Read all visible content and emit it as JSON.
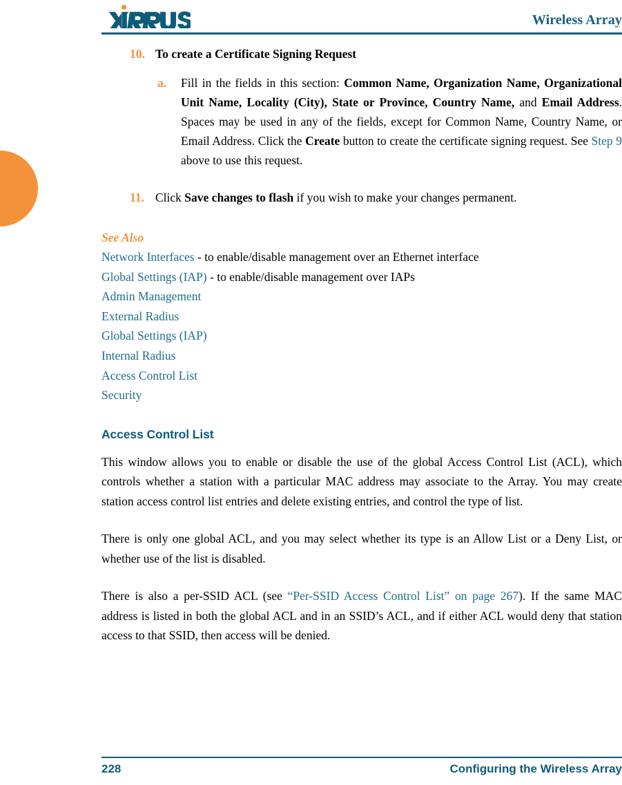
{
  "header": {
    "logo_text": "XIRRUS",
    "logo_trademark": "®",
    "title": "Wireless Array"
  },
  "colors": {
    "teal": "#0d5c79",
    "link_teal": "#1d6e8c",
    "orange": "#f4923b",
    "text": "#000000"
  },
  "steps": [
    {
      "marker": "10.",
      "text": "To create a Certificate Signing Request",
      "substeps": [
        {
          "marker": "a.",
          "seg1": "Fill in the fields in this section: ",
          "b1": "Common Name, Organization Name, Organizational Unit Name, Locality (City), State or Province, Country Name,",
          "seg2": " and ",
          "b2": "Email Address",
          "seg3": ". Spaces may be used in any of the fields, except for Common Name, Country Name, or Email Address. Click the ",
          "b3": "Create",
          "seg4": " button to create the certificate signing request. See ",
          "link": "Step 9",
          "seg5": " above to use this request."
        }
      ]
    },
    {
      "marker": "11.",
      "seg1": "Click ",
      "b1": "Save changes to flash",
      "seg2": " if you wish to make your changes permanent."
    }
  ],
  "see_also": {
    "title": "See Also",
    "entries": [
      {
        "link": "Network Interfaces",
        "suffix": " - to enable/disable management over an Ethernet interface"
      },
      {
        "link": "Global Settings (IAP)",
        "suffix": " - to enable/disable management over IAPs"
      },
      {
        "link": "Admin Management",
        "suffix": ""
      },
      {
        "link": "External Radius",
        "suffix": ""
      },
      {
        "link": "Global Settings (IAP)",
        "suffix": ""
      },
      {
        "link": "Internal Radius",
        "suffix": ""
      },
      {
        "link": "Access Control List",
        "suffix": ""
      },
      {
        "link": "Security",
        "suffix": ""
      }
    ]
  },
  "section": {
    "heading": "Access Control List",
    "paragraphs": [
      "This window allows you to enable or disable the use of the global Access Control List (ACL), which controls whether a station with a particular MAC address may associate to the Array. You may create station access control list entries and delete existing entries, and control the type of list.",
      "There is only one global ACL, and you may select whether its type is an Allow List or a Deny List, or whether use of the list is disabled."
    ],
    "final_paragraph": {
      "seg1": "There is also a per-SSID ACL (see ",
      "link": "“Per-SSID Access Control List” on page 267",
      "seg2": "). If the same MAC address is listed in both the global ACL and in an SSID’s ACL, and if either ACL would deny that station access to that SSID, then access will be denied."
    }
  },
  "footer": {
    "page_number": "228",
    "section_title": "Configuring the Wireless Array"
  }
}
